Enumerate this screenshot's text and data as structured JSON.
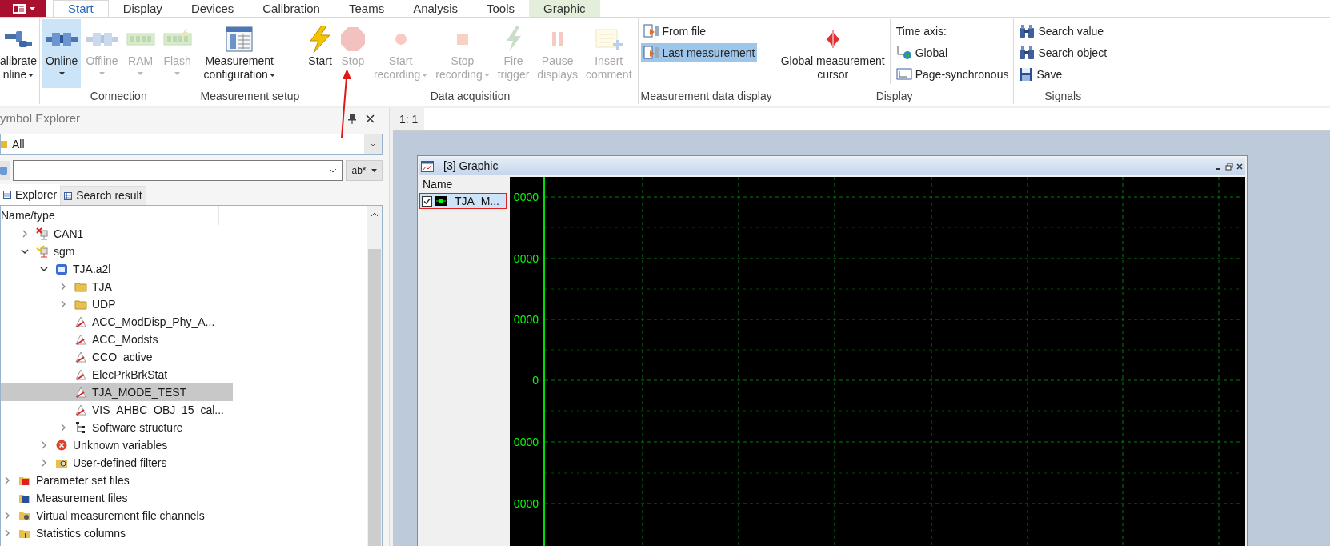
{
  "menu_tabs": [
    {
      "label": "Start",
      "selected": true,
      "contextual": false
    },
    {
      "label": "Display",
      "selected": false,
      "contextual": false
    },
    {
      "label": "Devices",
      "selected": false,
      "contextual": false
    },
    {
      "label": "Calibration",
      "selected": false,
      "contextual": false
    },
    {
      "label": "Teams",
      "selected": false,
      "contextual": false
    },
    {
      "label": "Analysis",
      "selected": false,
      "contextual": false
    },
    {
      "label": "Tools",
      "selected": false,
      "contextual": false
    },
    {
      "label": "Graphic",
      "selected": false,
      "contextual": true
    }
  ],
  "ribbon": [
    {
      "items": [
        {
          "kind": "large",
          "lines": [
            "alibrate",
            "nline"
          ],
          "dropdown": true
        }
      ]
    },
    {
      "label": "Connection",
      "items": [
        {
          "kind": "large",
          "lines": [
            "Online"
          ],
          "dropdown": true,
          "disabled": false,
          "selected": true
        },
        {
          "kind": "large",
          "lines": [
            "Offline"
          ],
          "dropdown": true,
          "disabled": true,
          "selected": false
        },
        {
          "kind": "large",
          "lines": [
            "RAM"
          ],
          "dropdown": true,
          "disabled": true,
          "selected": false
        },
        {
          "kind": "large",
          "lines": [
            "Flash"
          ],
          "dropdown": true,
          "disabled": true,
          "selected": false
        }
      ]
    },
    {
      "label": "Measurement setup",
      "items": [
        {
          "kind": "large",
          "lines": [
            "Measurement",
            "configuration"
          ],
          "dropdown": true
        }
      ]
    },
    {
      "label": "Data acquisition",
      "items": [
        {
          "kind": "large",
          "lines": [
            "Start"
          ],
          "disabled": false
        },
        {
          "kind": "large",
          "lines": [
            "Stop"
          ],
          "disabled": true
        },
        {
          "kind": "large",
          "lines": [
            "Start",
            "recording"
          ],
          "dropdown": true,
          "disabled": true
        },
        {
          "kind": "large",
          "lines": [
            "Stop",
            "recording"
          ],
          "dropdown": true,
          "disabled": true
        },
        {
          "kind": "large",
          "lines": [
            "Fire",
            "trigger"
          ],
          "disabled": true
        },
        {
          "kind": "large",
          "lines": [
            "Pause",
            "displays"
          ],
          "disabled": true
        },
        {
          "kind": "large",
          "lines": [
            "Insert",
            "comment"
          ],
          "disabled": true
        }
      ]
    },
    {
      "label": "Measurement data display",
      "items": [
        {
          "kind": "small",
          "lines": [
            "From file"
          ],
          "selected": false
        },
        {
          "kind": "small",
          "lines": [
            "Last measurement"
          ],
          "selected": true
        }
      ]
    },
    {
      "label": "Display",
      "items": [
        {
          "kind": "large",
          "lines": [
            "Global measurement",
            "cursor"
          ]
        },
        {
          "kind": "heading",
          "lines": [
            "Time axis:"
          ]
        },
        {
          "kind": "small",
          "lines": [
            "Global"
          ]
        },
        {
          "kind": "small",
          "lines": [
            "Page-synchronous"
          ]
        }
      ]
    },
    {
      "label": "Signals",
      "items": [
        {
          "kind": "small",
          "lines": [
            "Search value"
          ]
        },
        {
          "kind": "small",
          "lines": [
            "Search object"
          ]
        },
        {
          "kind": "small",
          "lines": [
            "Save"
          ]
        }
      ]
    }
  ],
  "symbol_explorer": {
    "title": "ymbol Explorer",
    "filter": "All",
    "search_mode": "ab*",
    "tabs": [
      {
        "label": "Explorer",
        "selected": true
      },
      {
        "label": "Search result",
        "selected": false
      }
    ],
    "column": "Name/type",
    "tree": [
      {
        "children": [
          {
            "label": "CAN1",
            "kind": "bus-error",
            "expanded": false,
            "selected": false
          },
          {
            "label": "sgm",
            "kind": "bus",
            "expanded": true,
            "selected": false,
            "children": [
              {
                "label": "TJA.a2l",
                "kind": "database",
                "expanded": true,
                "selected": false,
                "children": [
                  {
                    "label": "TJA",
                    "kind": "folder",
                    "expanded": false,
                    "selected": false
                  },
                  {
                    "label": "UDP",
                    "kind": "folder",
                    "expanded": false,
                    "selected": false
                  },
                  {
                    "label": "ACC_ModDisp_Phy_A...",
                    "kind": "signal",
                    "selected": false
                  },
                  {
                    "label": "ACC_Modsts",
                    "kind": "signal",
                    "selected": false
                  },
                  {
                    "label": "CCO_active",
                    "kind": "signal",
                    "selected": false
                  },
                  {
                    "label": "ElecPrkBrkStat",
                    "kind": "signal",
                    "selected": false
                  },
                  {
                    "label": "TJA_MODE_TEST",
                    "kind": "signal",
                    "selected": true
                  },
                  {
                    "label": "VIS_AHBC_OBJ_15_cal...",
                    "kind": "signal",
                    "selected": false
                  },
                  {
                    "label": "Software structure",
                    "kind": "structure",
                    "expanded": false,
                    "selected": false
                  }
                ]
              },
              {
                "label": "Unknown variables",
                "kind": "error",
                "expanded": false,
                "selected": false
              },
              {
                "label": "User-defined filters",
                "kind": "filter",
                "expanded": false,
                "selected": false
              }
            ]
          }
        ]
      },
      {
        "label": "Parameter set files",
        "kind": "param",
        "expanded": false,
        "selected": false
      },
      {
        "label": "Measurement files",
        "kind": "meas",
        "selected": false
      },
      {
        "label": "Virtual measurement file channels",
        "kind": "virtual",
        "expanded": false,
        "selected": false
      },
      {
        "label": "Statistics columns",
        "kind": "stats",
        "expanded": false,
        "selected": false
      }
    ]
  },
  "document": {
    "tab": "1: 1",
    "graphic_window": {
      "title": "[3] Graphic",
      "legend_header": "Name",
      "signals": [
        {
          "label": "TJA_M...",
          "checked": true,
          "selected": true
        }
      ],
      "y_labels": [
        "0000",
        "0000",
        "0000",
        "0",
        "0000",
        "0000"
      ]
    }
  }
}
